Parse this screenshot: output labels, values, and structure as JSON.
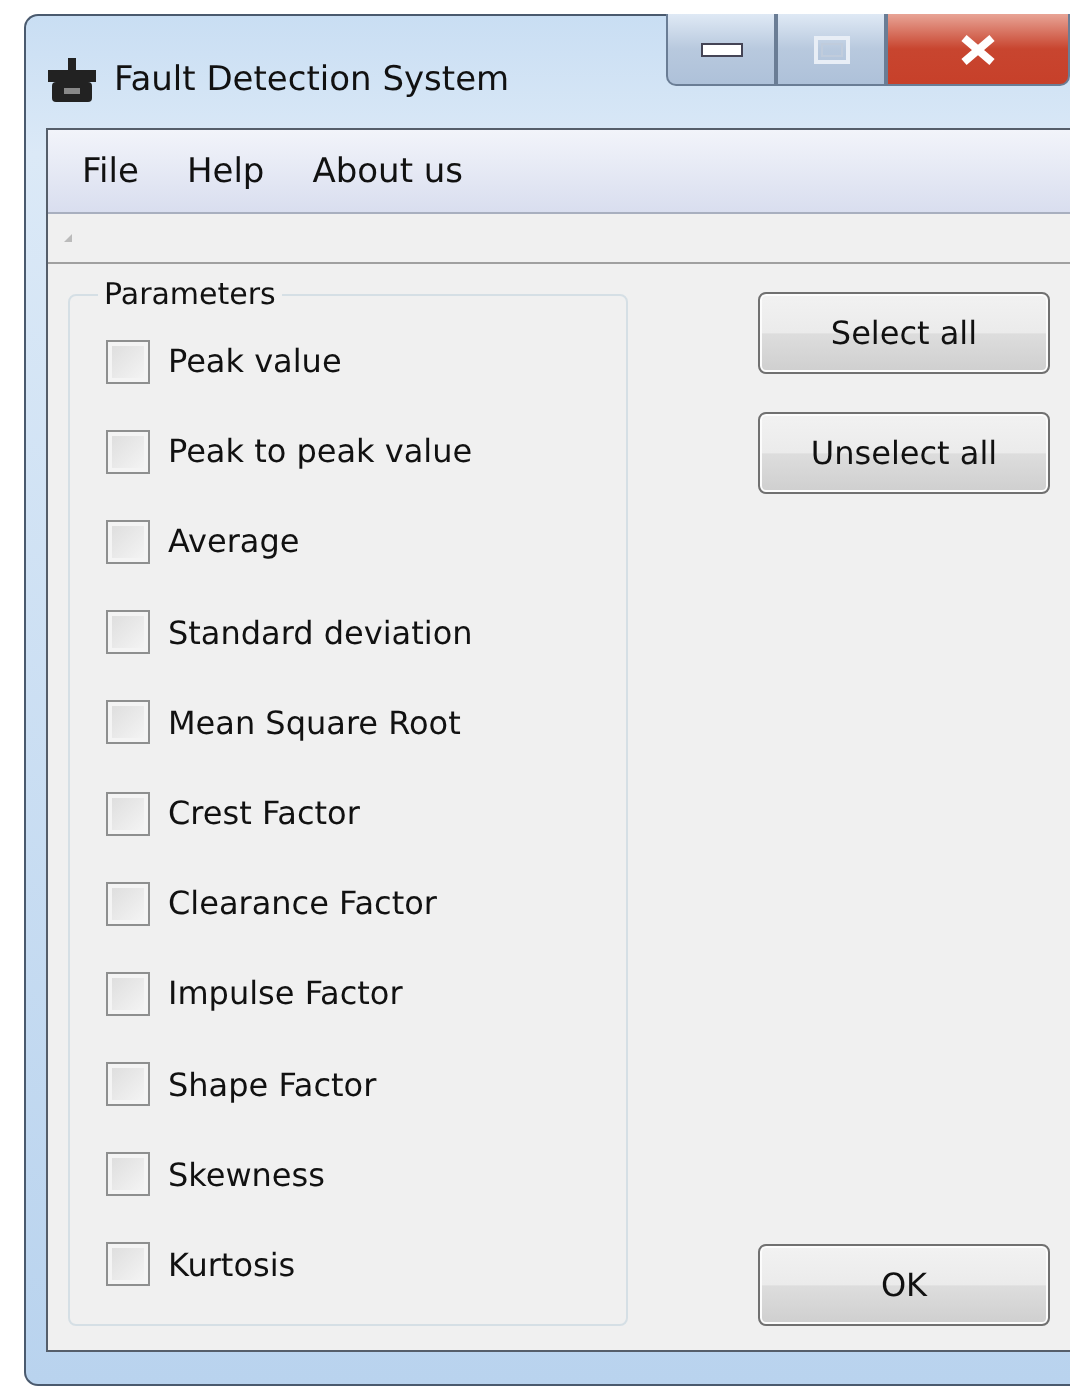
{
  "window": {
    "title": "Fault Detection System"
  },
  "menu": [
    "File",
    "Help",
    "About us"
  ],
  "parameters": {
    "title": "Parameters",
    "items": [
      {
        "label": "Peak value",
        "checked": false
      },
      {
        "label": "Peak to peak value",
        "checked": false
      },
      {
        "label": "Average",
        "checked": false
      },
      {
        "label": "Standard deviation",
        "checked": false
      },
      {
        "label": "Mean Square Root",
        "checked": false
      },
      {
        "label": "Crest Factor",
        "checked": false
      },
      {
        "label": "Clearance Factor",
        "checked": false
      },
      {
        "label": "Impulse Factor",
        "checked": false
      },
      {
        "label": "Shape Factor",
        "checked": false
      },
      {
        "label": "Skewness",
        "checked": false
      },
      {
        "label": "Kurtosis",
        "checked": false
      }
    ]
  },
  "buttons": {
    "top": [
      "Select all",
      "Unselect all"
    ],
    "bottom": [
      "OK"
    ]
  }
}
